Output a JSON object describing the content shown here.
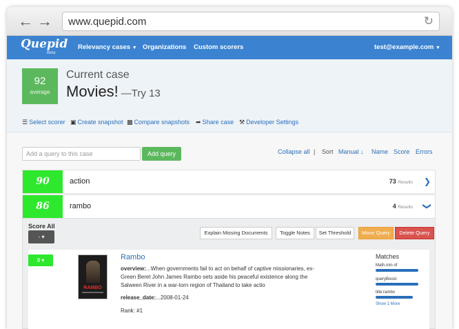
{
  "browser": {
    "url": "www.quepid.com",
    "back_icon": "arrow-left-icon",
    "forward_icon": "arrow-right-icon",
    "reload_icon": "reload-icon"
  },
  "nav": {
    "logo": "Quepid",
    "logo_badge": "Beta",
    "items": [
      "Relevancy cases",
      "Organizations",
      "Custom scorers"
    ],
    "user": "test@example.com",
    "color": "#3b83d1"
  },
  "case": {
    "score": "92",
    "score_label": "average",
    "current_label": "Current case",
    "name": "Movies!",
    "try_label": "—Try 13",
    "tools": [
      "Select scorer",
      "Create snapshot",
      "Compare snapshots",
      "Share case",
      "Developer Settings"
    ]
  },
  "query_controls": {
    "input_placeholder": "Add a query to this case",
    "add_button": "Add query",
    "collapse_all": "Collapse all",
    "sort_label": "Sort",
    "sort_options": [
      "Manual",
      "Name",
      "Score",
      "Errors"
    ]
  },
  "queries": [
    {
      "score": "90",
      "name": "action",
      "count": "73",
      "results_label": "Results"
    },
    {
      "score": "86",
      "name": "rambo",
      "count": "4",
      "results_label": "Results"
    }
  ],
  "expanded": {
    "score_all_label": "Score All",
    "score_all_value": "-",
    "buttons": [
      "Explain Missing Documents",
      "Toggle Notes",
      "Set Threshold",
      "Move Query",
      "Delete Query"
    ],
    "doc": {
      "score": "9",
      "poster_text": "RAMBO",
      "title": "Rambo",
      "overview_label": "overview:",
      "overview_lines": [
        "...When governments fail to act on behalf of captive missionaries, ex-",
        "Green Beret John James Rambo sets aside his peaceful existence along the",
        "Salween River in a war-torn region of Thailand to take actio"
      ],
      "release_label": "release_date:",
      "release_value": "...2008-01-24",
      "rank": "Rank: #1"
    },
    "matches": {
      "title": "Matches",
      "items": [
        "Math.min of",
        "queryBoost",
        "title:rambo"
      ],
      "show_more": "Show 1 More"
    }
  }
}
